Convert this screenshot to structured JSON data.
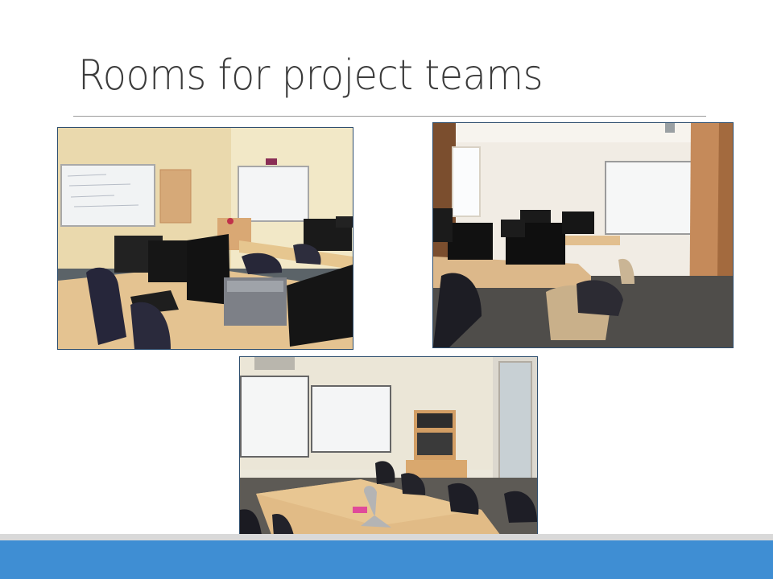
{
  "slide": {
    "title": "Rooms for project teams",
    "colors": {
      "title_text": "#3b3b3b",
      "rule": "#9a9a9a",
      "footer_accent": "#3f8ed3",
      "footer_band": "#d9d9d9"
    }
  },
  "photos": [
    {
      "subject": "computer-lab-room",
      "icon": "photo-icon"
    },
    {
      "subject": "computer-room-with-whiteboard",
      "icon": "photo-icon"
    },
    {
      "subject": "meeting-room-with-whiteboards",
      "icon": "photo-icon"
    }
  ]
}
